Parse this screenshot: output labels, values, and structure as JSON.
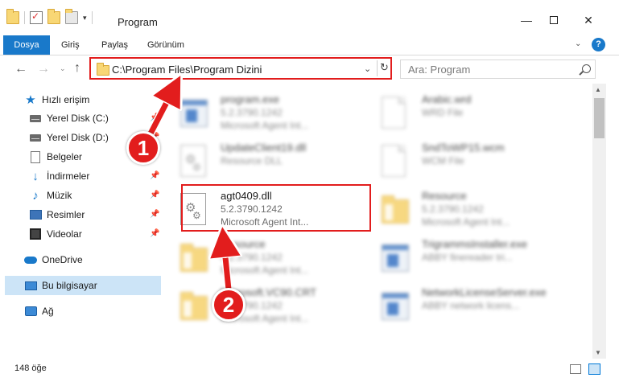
{
  "window": {
    "title": "Program",
    "minimize_glyph": "—",
    "close_glyph": "✕"
  },
  "ribbon": {
    "tabs": [
      {
        "label": "Dosya"
      },
      {
        "label": "Giriş"
      },
      {
        "label": "Paylaş"
      },
      {
        "label": "Görünüm"
      }
    ],
    "expand_glyph": "⌄",
    "help_glyph": "?"
  },
  "nav": {
    "back_glyph": "←",
    "forward_glyph": "→",
    "recent_glyph": "⌄",
    "up_glyph": "↑",
    "address": "C:\\Program Files\\Program Dizini",
    "address_dropdown_glyph": "⌄",
    "refresh_glyph": "↻",
    "search_placeholder": "Ara: Program"
  },
  "sidebar": {
    "pin_glyph": "📌",
    "items": [
      {
        "label": "Hızlı erişim",
        "icon": "star-icon"
      },
      {
        "label": "Yerel Disk (C:)",
        "icon": "drive-icon"
      },
      {
        "label": "Yerel Disk (D:)",
        "icon": "drive-icon"
      },
      {
        "label": "Belgeler",
        "icon": "document-icon"
      },
      {
        "label": "İndirmeler",
        "icon": "download-icon"
      },
      {
        "label": "Müzik",
        "icon": "music-icon"
      },
      {
        "label": "Resimler",
        "icon": "pictures-icon"
      },
      {
        "label": "Videolar",
        "icon": "videos-icon"
      },
      {
        "label": "OneDrive",
        "icon": "cloud-icon"
      },
      {
        "label": "Bu bilgisayar",
        "icon": "computer-icon"
      },
      {
        "label": "Ağ",
        "icon": "network-icon"
      }
    ]
  },
  "files": [
    {
      "name": "program.exe",
      "line2": "5.2.3790.1242",
      "line3": "Microsoft Agent Int...",
      "icon": "exe-icon"
    },
    {
      "name": "Arabic.wrd",
      "line2": "WRD File",
      "line3": "",
      "icon": "page-icon"
    },
    {
      "name": "UpdateClient19.dll",
      "line2": "Resource DLL",
      "line3": "",
      "icon": "dll-icon"
    },
    {
      "name": "SndToWP15.wcm",
      "line2": "WCM File",
      "line3": "",
      "icon": "page-icon"
    },
    {
      "name": "agt0409.dll",
      "line2": "5.2.3790.1242",
      "line3": "Microsoft Agent Int...",
      "icon": "dll-icon"
    },
    {
      "name": "Resource",
      "line2": "5.2.3790.1242",
      "line3": "Microsoft Agent Int...",
      "icon": "folder-icon"
    },
    {
      "name": "Resource",
      "line2": "5.2.3790.1242",
      "line3": "Microsoft Agent Int...",
      "icon": "folder-icon"
    },
    {
      "name": "TrigrammsInstaller.exe",
      "line2": "ABBY finereader tri...",
      "line3": "",
      "icon": "exe-icon"
    },
    {
      "name": "Microsoft.VC90.CRT",
      "line2": "5.2.3790.1242",
      "line3": "Microsoft Agent Int...",
      "icon": "folder-icon"
    },
    {
      "name": "NetworkLicenseServer.exe",
      "line2": "ABBY network licens...",
      "line3": "",
      "icon": "exe-icon"
    }
  ],
  "status": {
    "count": "148 öğe"
  },
  "annotations": {
    "step1": "1",
    "step2": "2",
    "color": "#e21d1d"
  },
  "colors": {
    "accent": "#1979ca",
    "selection": "#cce4f7"
  }
}
